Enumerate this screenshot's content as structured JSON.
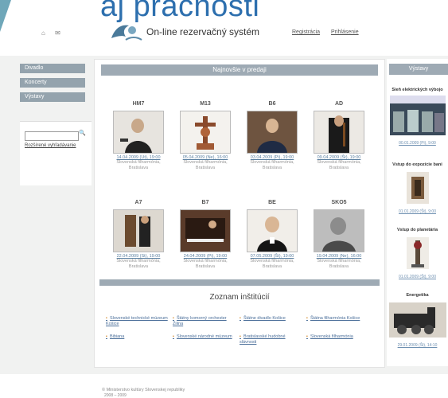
{
  "header": {
    "big_title": "aj pracnosti",
    "logo_text": "On-line rezervačný systém",
    "home_icon": "home-icon",
    "mail_icon": "mail-icon",
    "links": [
      "Registrácia",
      "Prihlásenie"
    ]
  },
  "nav": [
    "Divadlo",
    "Koncerty",
    "Výstavy"
  ],
  "search": {
    "placeholder": "",
    "advanced_link": "Rozšírené vyhľadávanie",
    "icon": "magnifier-icon"
  },
  "main": {
    "heading": "Najnovšie v predaji",
    "cards": [
      {
        "code": "HM7",
        "date": "14.04.2009 (Ut), 19:00",
        "venue": "Slovenská filharmónia, Bratislava"
      },
      {
        "code": "M13",
        "date": "05.04.2009 (Ne), 16:00",
        "venue": "Slovenská filharmónia, Bratislava"
      },
      {
        "code": "B6",
        "date": "03.04.2009 (Pi), 19:00",
        "venue": "Slovenská filharmónia, Bratislava"
      },
      {
        "code": "AD",
        "date": "09.04.2009 (Št), 19:00",
        "venue": "Slovenská filharmónia, Bratislava"
      },
      {
        "code": "A7",
        "date": "22.04.2009 (St), 19:00",
        "venue": "Slovenská filharmónia, Bratislava"
      },
      {
        "code": "B7",
        "date": "24.04.2009 (Pi), 19:00",
        "venue": "Slovenská filharmónia, Bratislava"
      },
      {
        "code": "BE",
        "date": "07.05.2009 (Št), 19:00",
        "venue": "Slovenská filharmónia, Bratislava"
      },
      {
        "code": "SKO5",
        "date": "19.04.2009 (Ne), 16:00",
        "venue": "Slovenská filharmónia, Bratislava"
      }
    ],
    "institutions_title": "Zoznam inštitúcií",
    "institutions": [
      "Slovenské technické múzeum Košice",
      "Štátny komorný orchester Žilina",
      "Štátne divadlo Košice",
      "Štátna filharmónia Košice",
      "Bibiana",
      "Slovenské národné múzeum",
      "Bratislavské hudobné slávnosti",
      "Slovenská filharmónia"
    ]
  },
  "right": {
    "heading": "Výstavy",
    "items": [
      {
        "title": "Sieň elektrických výbojo",
        "date": "00.01.2009 (Pi), 9:00"
      },
      {
        "title": "Vstup do expozície bani",
        "date": "01.01.2009 (Št), 9:00"
      },
      {
        "title": "Vstup do planetária",
        "date": "01.01.2009 (Št), 9:00"
      },
      {
        "title": "Energetika",
        "date": "29.01.2009 (Št), 14:10"
      }
    ]
  },
  "footer": {
    "line1": "© Ministerstvo kultúry Slovenskej republiky",
    "line2": "2008 – 2009"
  }
}
